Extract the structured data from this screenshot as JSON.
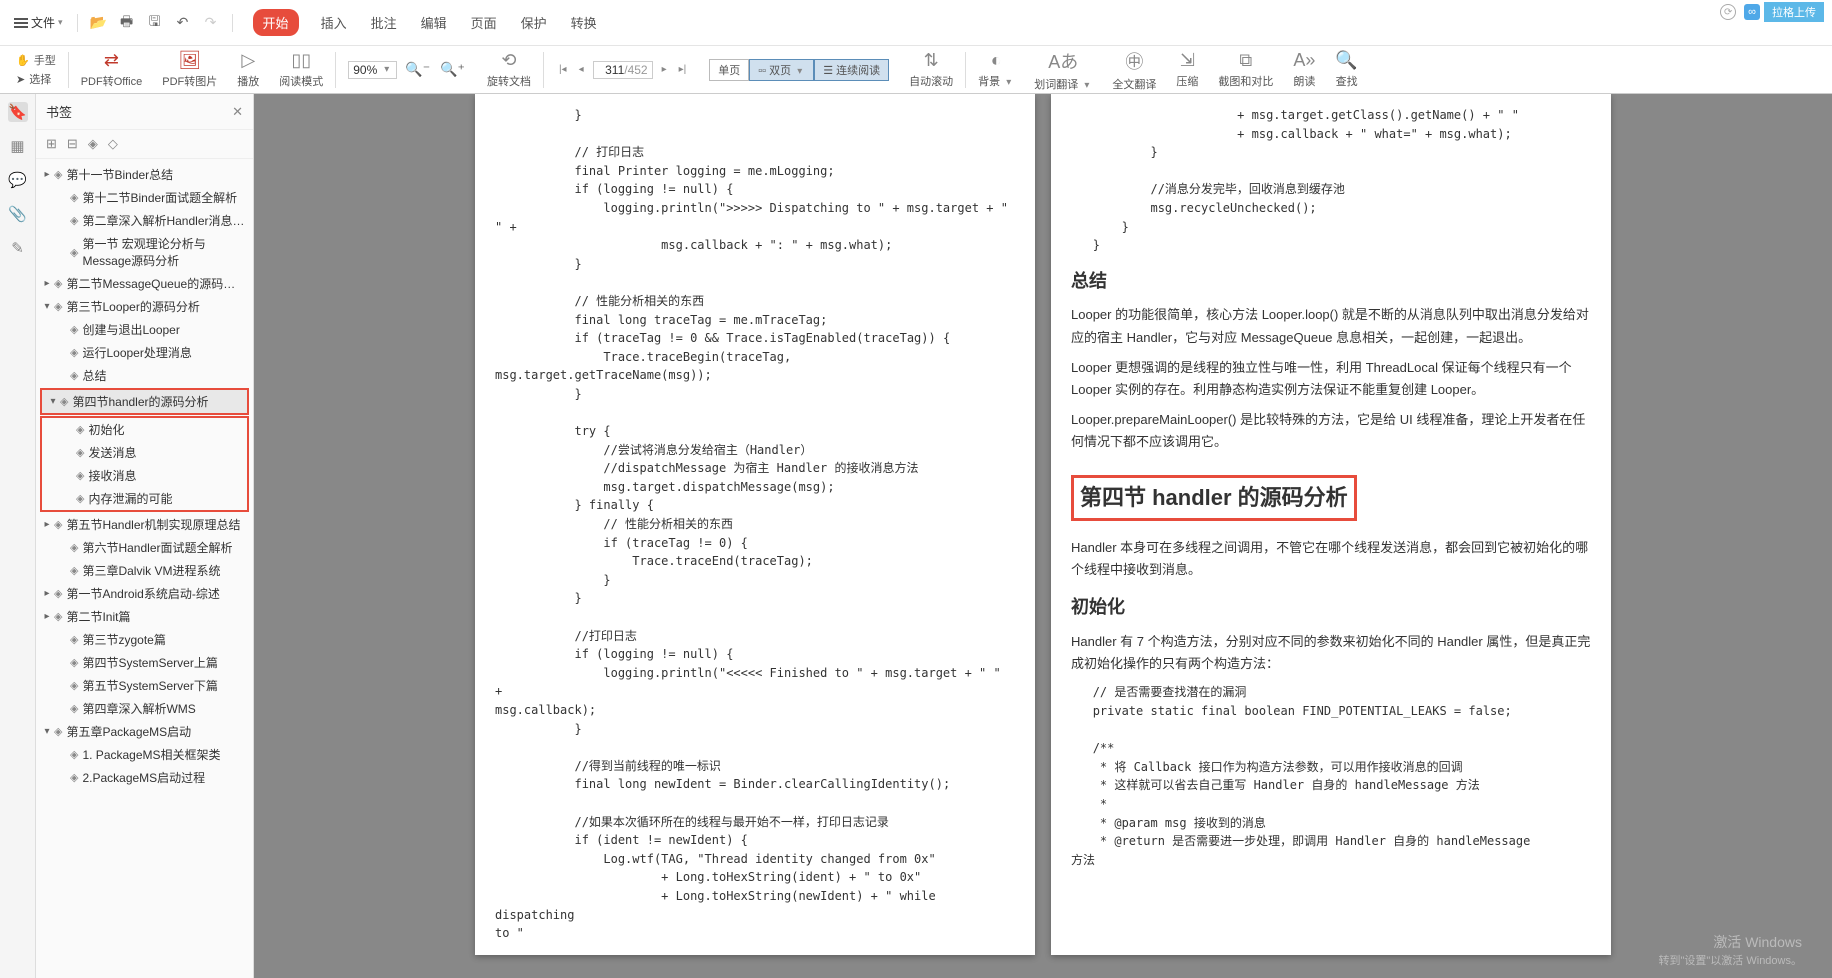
{
  "menu": {
    "file": "文件"
  },
  "tabs": [
    "开始",
    "插入",
    "批注",
    "编辑",
    "页面",
    "保护",
    "转换"
  ],
  "active_tab": 0,
  "cloud": {
    "label": "拉格上传"
  },
  "ribbon": {
    "hand": "手型",
    "select": "选择",
    "pdf_office": "PDF转Office",
    "pdf_image": "PDF转图片",
    "play": "播放",
    "read_mode": "阅读模式",
    "zoom": "90%",
    "rotate": "旋转文档",
    "single": "单页",
    "double": "双页",
    "cont": "连续阅读",
    "autoscroll": "自动滚动",
    "bg": "背景",
    "dict": "划词翻译",
    "fulltrans": "全文翻译",
    "compress": "压缩",
    "screenshot": "截图和对比",
    "readaloud": "朗读",
    "find": "查找"
  },
  "page_nav": {
    "current": "311",
    "total": "/452"
  },
  "sidebar": {
    "title": "书签",
    "items": [
      {
        "d": 0,
        "tw": "▸",
        "t": "第十一节Binder总结"
      },
      {
        "d": 1,
        "tw": "",
        "t": "第十二节Binder面试题全解析"
      },
      {
        "d": 1,
        "tw": "",
        "t": "第二章深入解析Handler消息机制"
      },
      {
        "d": 1,
        "tw": "",
        "t": "第一节 宏观理论分析与Message源码分析",
        "wrap": true
      },
      {
        "d": 0,
        "tw": "▸",
        "t": "第二节MessageQueue的源码分析"
      },
      {
        "d": 0,
        "tw": "▾",
        "t": "第三节Looper的源码分析"
      },
      {
        "d": 1,
        "tw": "",
        "t": "创建与退出Looper"
      },
      {
        "d": 1,
        "tw": "",
        "t": "运行Looper处理消息"
      },
      {
        "d": 1,
        "tw": "",
        "t": "总结"
      }
    ],
    "hl1": [
      {
        "d": 0,
        "tw": "▾",
        "t": "第四节handler的源码分析",
        "sel": true
      }
    ],
    "hl2": [
      {
        "d": 1,
        "tw": "",
        "t": "初始化"
      },
      {
        "d": 1,
        "tw": "",
        "t": "发送消息"
      },
      {
        "d": 1,
        "tw": "",
        "t": "接收消息"
      },
      {
        "d": 1,
        "tw": "",
        "t": "内存泄漏的可能"
      }
    ],
    "items2": [
      {
        "d": 0,
        "tw": "▸",
        "t": "第五节Handler机制实现原理总结"
      },
      {
        "d": 1,
        "tw": "",
        "t": "第六节Handler面试题全解析"
      },
      {
        "d": 1,
        "tw": "",
        "t": "第三章Dalvik VM进程系统"
      },
      {
        "d": 0,
        "tw": "▸",
        "t": "第一节Android系统启动-综述"
      },
      {
        "d": 0,
        "tw": "▸",
        "t": "第二节Init篇"
      },
      {
        "d": 1,
        "tw": "",
        "t": "第三节zygote篇"
      },
      {
        "d": 1,
        "tw": "",
        "t": "第四节SystemServer上篇"
      },
      {
        "d": 1,
        "tw": "",
        "t": "第五节SystemServer下篇"
      },
      {
        "d": 1,
        "tw": "",
        "t": "第四章深入解析WMS"
      },
      {
        "d": 0,
        "tw": "▾",
        "t": "第五章PackageMS启动"
      },
      {
        "d": 1,
        "tw": "",
        "t": "1. PackageMS相关框架类"
      },
      {
        "d": 1,
        "tw": "",
        "t": "2.PackageMS启动过程"
      }
    ]
  },
  "doc": {
    "left_code": "           }\n\n           // 打印日志\n           final Printer logging = me.mLogging;\n           if (logging != null) {\n               logging.println(\">>>>> Dispatching to \" + msg.target + \"\n\" +\n                       msg.callback + \": \" + msg.what);\n           }\n\n           // 性能分析相关的东西\n           final long traceTag = me.mTraceTag;\n           if (traceTag != 0 && Trace.isTagEnabled(traceTag)) {\n               Trace.traceBegin(traceTag,\nmsg.target.getTraceName(msg));\n           }\n\n           try {\n               //尝试将消息分发给宿主（Handler）\n               //dispatchMessage 为宿主 Handler 的接收消息方法\n               msg.target.dispatchMessage(msg);\n           } finally {\n               // 性能分析相关的东西\n               if (traceTag != 0) {\n                   Trace.traceEnd(traceTag);\n               }\n           }\n\n           //打印日志\n           if (logging != null) {\n               logging.println(\"<<<<< Finished to \" + msg.target + \" \" +\nmsg.callback);\n           }\n\n           //得到当前线程的唯一标识\n           final long newIdent = Binder.clearCallingIdentity();\n\n           //如果本次循环所在的线程与最开始不一样，打印日志记录\n           if (ident != newIdent) {\n               Log.wtf(TAG, \"Thread identity changed from 0x\"\n                       + Long.toHexString(ident) + \" to 0x\"\n                       + Long.toHexString(newIdent) + \" while dispatching\nto \"",
    "right_top": "                       + msg.target.getClass().getName() + \" \"\n                       + msg.callback + \" what=\" + msg.what);\n           }\n\n           //消息分发完毕，回收消息到缓存池\n           msg.recycleUnchecked();\n       }\n   }",
    "summary_h": "总结",
    "summary_p1": "Looper 的功能很简单，核心方法 Looper.loop() 就是不断的从消息队列中取出消息分发给对应的宿主 Handler，它与对应 MessageQueue 息息相关，一起创建，一起退出。",
    "summary_p2": "Looper 更想强调的是线程的独立性与唯一性，利用 ThreadLocal 保证每个线程只有一个 Looper 实例的存在。利用静态构造实例方法保证不能重复创建 Looper。",
    "summary_p3": "Looper.prepareMainLooper() 是比较特殊的方法，它是给 UI 线程准备，理论上开发者在任何情况下都不应该调用它。",
    "sec4_h": "第四节 handler 的源码分析",
    "sec4_p": "Handler 本身可在多线程之间调用，不管它在哪个线程发送消息，都会回到它被初始化的哪个线程中接收到消息。",
    "init_h": "初始化",
    "init_p": "Handler 有 7 个构造方法，分别对应不同的参数来初始化不同的 Handler 属性，但是真正完成初始化操作的只有两个构造方法：",
    "init_code": "   // 是否需要查找潜在的漏洞\n   private static final boolean FIND_POTENTIAL_LEAKS = false;\n\n   /**\n    * 将 Callback 接口作为构造方法参数，可以用作接收消息的回调\n    * 这样就可以省去自己重写 Handler 自身的 handleMessage 方法\n    *\n    * @param msg 接收到的消息\n    * @return 是否需要进一步处理，即调用 Handler 自身的 handleMessage\n方法"
  },
  "watermark": {
    "l1": "激活 Windows",
    "l2": "转到\"设置\"以激活 Windows。"
  }
}
